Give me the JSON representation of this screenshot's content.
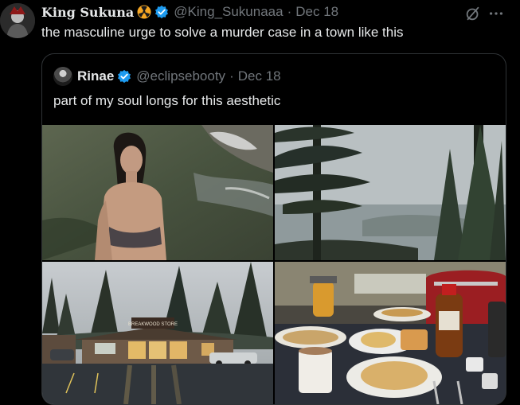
{
  "tweet": {
    "display_name": "King Sukuna",
    "handle": "@King_Sukunaaa",
    "separator": "·",
    "date": "Dec 18",
    "text": "the masculine urge to solve a murder case in a town like this",
    "icons": [
      "avatar",
      "radioactive-badge-icon",
      "verified-badge-icon",
      "grok-icon",
      "more-icon"
    ]
  },
  "quote": {
    "display_name": "Rinae",
    "handle": "@eclipsebooty",
    "separator": "·",
    "date": "Dec 18",
    "text": "part of my soul longs for this aesthetic",
    "icons": [
      "avatar",
      "verified-badge-icon"
    ]
  },
  "media": {
    "images": [
      {
        "name": "woman-in-river-photo"
      },
      {
        "name": "foggy-coast-trees-photo"
      },
      {
        "name": "general-store-rain-photo",
        "sign_text": "BREAKWOOD STORE"
      },
      {
        "name": "diner-table-photo"
      }
    ]
  },
  "colors": {
    "background": "#000000",
    "text": "#e7e9ea",
    "muted": "#71767b",
    "border": "#2f3336",
    "verified": "#1d9bf0",
    "radioactive": "#f5a623"
  }
}
